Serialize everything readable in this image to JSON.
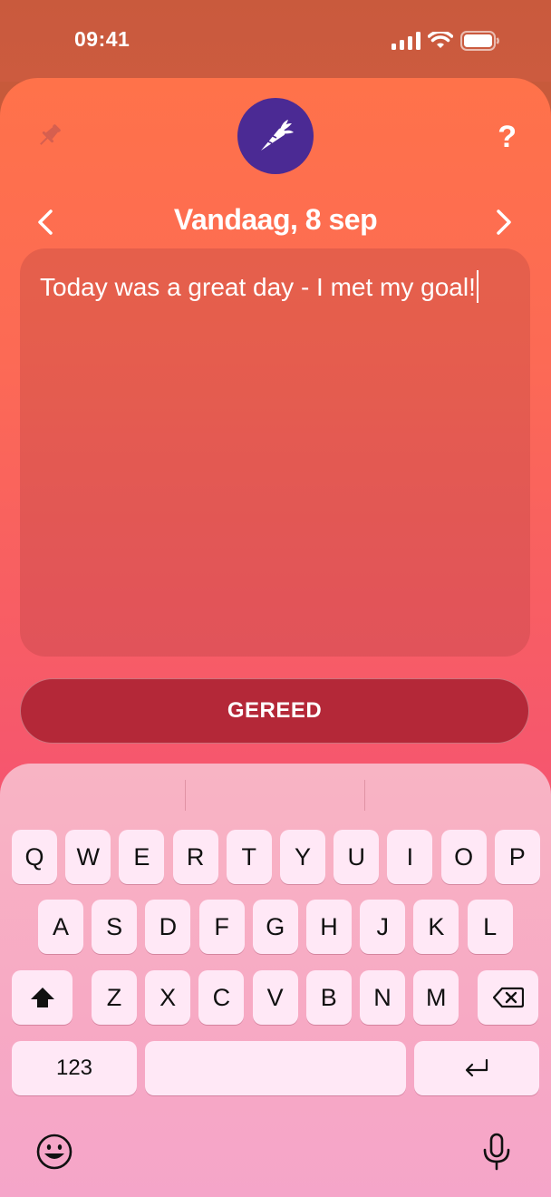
{
  "status": {
    "time": "09:41"
  },
  "header": {
    "pin_icon": "pin-icon",
    "logo_icon": "carrot-icon",
    "help_label": "?"
  },
  "date_nav": {
    "title": "Vandaag, 8 sep",
    "prev_icon": "chevron-left-icon",
    "next_icon": "chevron-right-icon"
  },
  "note": {
    "text": "Today was a great day - I met my goal!"
  },
  "done_button": {
    "label": "GEREED"
  },
  "keyboard": {
    "row1": [
      "Q",
      "W",
      "E",
      "R",
      "T",
      "Y",
      "U",
      "I",
      "O",
      "P"
    ],
    "row2": [
      "A",
      "S",
      "D",
      "F",
      "G",
      "H",
      "J",
      "K",
      "L"
    ],
    "row3": [
      "Z",
      "X",
      "C",
      "V",
      "B",
      "N",
      "M"
    ],
    "numbers_label": "123",
    "shift_icon": "shift-icon",
    "delete_icon": "backspace-icon",
    "return_icon": "return-icon",
    "emoji_icon": "emoji-icon",
    "mic_icon": "microphone-icon"
  },
  "colors": {
    "logo_bg": "#4b2a94",
    "done_bg": "#b42838"
  }
}
